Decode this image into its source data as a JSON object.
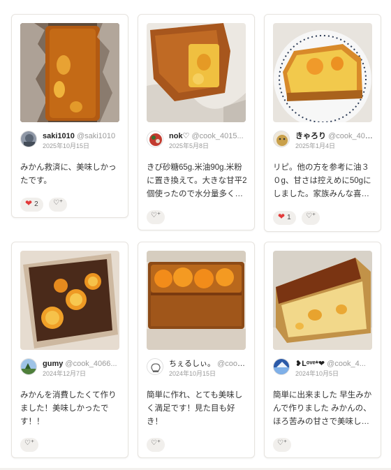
{
  "cards": [
    {
      "author_name": "saki1010",
      "author_handle": "@saki1010",
      "date": "2025年10月15日",
      "comment": "みかん救済に、美味しかったです。",
      "reaction_count": "2",
      "has_heart": true
    },
    {
      "author_name": "nok♡",
      "author_handle": "@cook_4015...",
      "date": "2025年5月8日",
      "comment": "きび砂糖65g.米油90g.米粉に置き換えて。大きな甘平2個使ったので水分量多く…",
      "reaction_count": "",
      "has_heart": false
    },
    {
      "author_name": "きゃろり",
      "author_handle": "@cook_404...",
      "date": "2025年1月4日",
      "comment": "リピ。他の方を参考に油３０g、甘さは控えめに50gにしました。家族みんな喜…",
      "reaction_count": "1",
      "has_heart": true
    },
    {
      "author_name": "gumy",
      "author_handle": "@cook_4066...",
      "date": "2024年12月7日",
      "comment": "みかんを消費したくて作りました！美味しかったです！！",
      "reaction_count": "",
      "has_heart": false
    },
    {
      "author_name": "ちぇるしぃ。",
      "author_handle": "@cook_...",
      "date": "2024年10月15日",
      "comment": "簡単に作れ、とても美味しく満足です！見た目も好き！",
      "reaction_count": "",
      "has_heart": false
    },
    {
      "author_name": "❥Lᵒᵛᵉ*❤",
      "author_handle": "@cook_4...",
      "date": "2024年10月5日",
      "comment": "簡単に出来ました 早生みかんで作りました みかんの、ほろ苦みの甘さで美味し…",
      "reaction_count": "",
      "has_heart": false
    }
  ],
  "icons": {
    "heart": "heart-icon",
    "add_reaction": "heart-plus-icon"
  },
  "colors": {
    "heart_red": "#e23b3b",
    "pill_bg": "#f1efec",
    "muted_text": "#999999",
    "card_border": "#e6e3de"
  }
}
